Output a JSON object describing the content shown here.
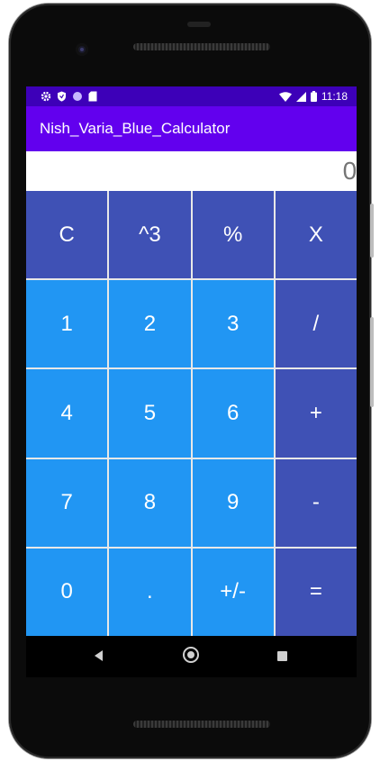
{
  "status_bar": {
    "time": "11:18",
    "icons_left": [
      "gear-icon",
      "shield-icon",
      "circle-icon",
      "sd-card-icon"
    ],
    "icons_right": [
      "wifi-icon",
      "signal-icon",
      "battery-icon"
    ]
  },
  "app_bar": {
    "title": "Nish_Varia_Blue_Calculator",
    "color": "#6200ee"
  },
  "display": {
    "value": "0."
  },
  "colors": {
    "operator_key": "#3f51b5",
    "digit_key": "#2196f3",
    "status_bar": "#3d00b8"
  },
  "keys": [
    {
      "label": "C",
      "style": "dark"
    },
    {
      "label": "^3",
      "style": "dark"
    },
    {
      "label": "%",
      "style": "dark"
    },
    {
      "label": "X",
      "style": "dark"
    },
    {
      "label": "1",
      "style": "light"
    },
    {
      "label": "2",
      "style": "light"
    },
    {
      "label": "3",
      "style": "light"
    },
    {
      "label": "/",
      "style": "dark"
    },
    {
      "label": "4",
      "style": "light"
    },
    {
      "label": "5",
      "style": "light"
    },
    {
      "label": "6",
      "style": "light"
    },
    {
      "label": "+",
      "style": "dark"
    },
    {
      "label": "7",
      "style": "light"
    },
    {
      "label": "8",
      "style": "light"
    },
    {
      "label": "9",
      "style": "light"
    },
    {
      "label": "-",
      "style": "dark"
    },
    {
      "label": "0",
      "style": "light"
    },
    {
      "label": ".",
      "style": "light"
    },
    {
      "label": "+/-",
      "style": "light"
    },
    {
      "label": "=",
      "style": "dark"
    }
  ],
  "nav_bar": {
    "buttons": [
      "back-icon",
      "home-icon",
      "recents-icon"
    ]
  }
}
